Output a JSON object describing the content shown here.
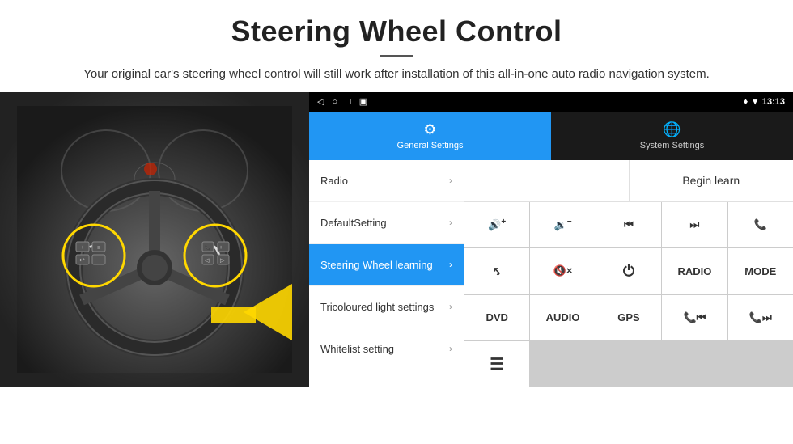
{
  "header": {
    "title": "Steering Wheel Control",
    "subtitle": "Your original car's steering wheel control will still work after installation of this all-in-one auto radio navigation system."
  },
  "status_bar": {
    "nav_back": "◁",
    "nav_home": "○",
    "nav_recent": "□",
    "nav_cast": "▣",
    "location_icon": "♦",
    "wifi_icon": "▾",
    "time": "13:13"
  },
  "tabs": [
    {
      "id": "general",
      "label": "General Settings",
      "active": true
    },
    {
      "id": "system",
      "label": "System Settings",
      "active": false
    }
  ],
  "menu": {
    "items": [
      {
        "id": "radio",
        "label": "Radio",
        "active": false
      },
      {
        "id": "default-setting",
        "label": "DefaultSetting",
        "active": false
      },
      {
        "id": "steering-wheel",
        "label": "Steering Wheel learning",
        "active": true
      },
      {
        "id": "tricoloured",
        "label": "Tricoloured light settings",
        "active": false
      },
      {
        "id": "whitelist",
        "label": "Whitelist setting",
        "active": false
      }
    ]
  },
  "right_panel": {
    "begin_learn_label": "Begin learn",
    "controls": [
      {
        "id": "vol-up",
        "label": "🔊+",
        "type": "icon"
      },
      {
        "id": "vol-down",
        "label": "🔉-",
        "type": "icon"
      },
      {
        "id": "prev",
        "label": "⏮",
        "type": "icon"
      },
      {
        "id": "next",
        "label": "⏭",
        "type": "icon"
      },
      {
        "id": "phone",
        "label": "📞",
        "type": "icon"
      },
      {
        "id": "hangup",
        "label": "↩",
        "type": "icon"
      },
      {
        "id": "mute",
        "label": "🔇×",
        "type": "icon"
      },
      {
        "id": "power",
        "label": "⏻",
        "type": "icon"
      },
      {
        "id": "radio-btn",
        "label": "RADIO",
        "type": "text"
      },
      {
        "id": "mode",
        "label": "MODE",
        "type": "text"
      },
      {
        "id": "dvd",
        "label": "DVD",
        "type": "text"
      },
      {
        "id": "audio",
        "label": "AUDIO",
        "type": "text"
      },
      {
        "id": "gps",
        "label": "GPS",
        "type": "text"
      },
      {
        "id": "tel-prev",
        "label": "📞⏮",
        "type": "icon"
      },
      {
        "id": "tel-next",
        "label": "📞⏭",
        "type": "icon"
      },
      {
        "id": "list",
        "label": "☰",
        "type": "icon"
      }
    ]
  }
}
